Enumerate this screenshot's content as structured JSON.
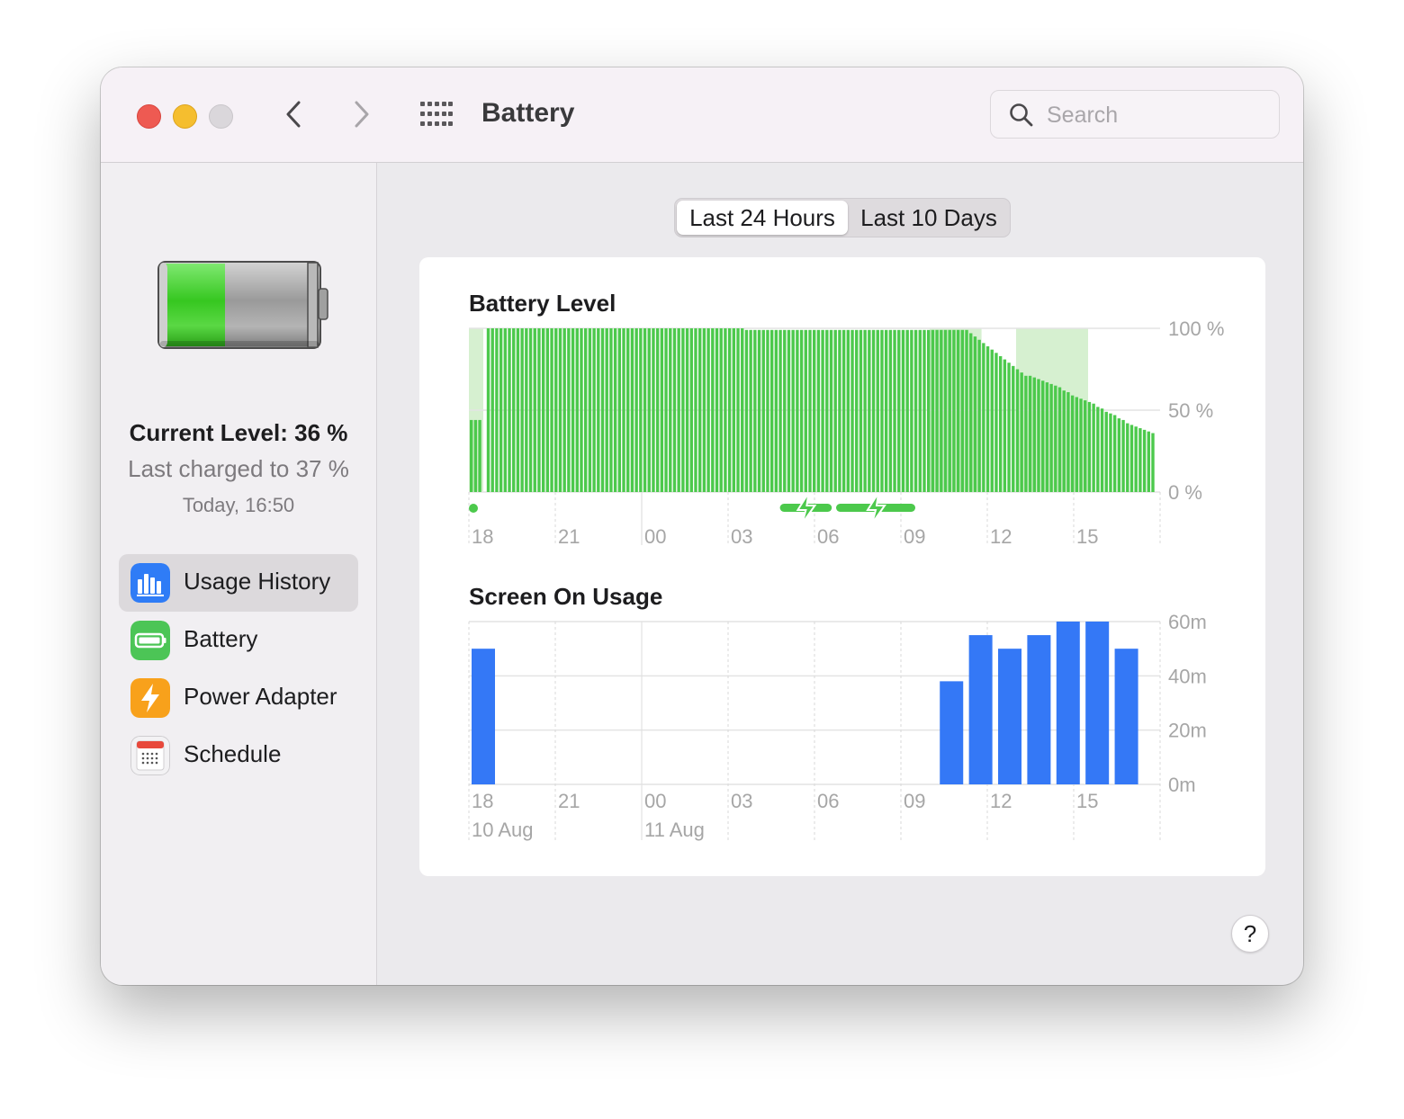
{
  "window": {
    "title": "Battery",
    "search": {
      "placeholder": "Search",
      "value": ""
    }
  },
  "sidebar": {
    "battery_icon": "battery-icon",
    "current_level": "Current Level: 36 %",
    "last_charged": "Last charged to 37 %",
    "charged_time": "Today, 16:50",
    "items": [
      {
        "label": "Usage History",
        "icon": "chart-icon",
        "color": "#2f7cf6",
        "selected": true
      },
      {
        "label": "Battery",
        "icon": "battery-icon",
        "color": "#4cc556",
        "selected": false
      },
      {
        "label": "Power Adapter",
        "icon": "bolt-icon",
        "color": "#f8a11b",
        "selected": false
      },
      {
        "label": "Schedule",
        "icon": "calendar-icon",
        "color": "#e5e3e6",
        "selected": false
      }
    ]
  },
  "range": {
    "options": [
      "Last 24 Hours",
      "Last 10 Days"
    ],
    "selected": "Last 24 Hours"
  },
  "help": {
    "label": "?"
  },
  "chart_data": [
    {
      "type": "bar",
      "title": "Battery Level",
      "color": "#4cc94c",
      "charging_color": "#d6f0d0",
      "ylim": [
        0,
        100
      ],
      "y_ticks": [
        "100 %",
        "50 %",
        "0 %"
      ],
      "x_ticks": [
        "18",
        "21",
        "00",
        "03",
        "06",
        "09",
        "12",
        "15"
      ],
      "values": [
        44,
        44,
        44,
        0,
        100,
        100,
        100,
        100,
        100,
        100,
        100,
        100,
        100,
        100,
        100,
        100,
        100,
        100,
        100,
        100,
        100,
        100,
        100,
        100,
        100,
        100,
        100,
        100,
        100,
        100,
        100,
        100,
        100,
        100,
        100,
        100,
        100,
        100,
        100,
        100,
        100,
        100,
        100,
        100,
        100,
        100,
        100,
        100,
        100,
        100,
        100,
        100,
        100,
        100,
        100,
        100,
        100,
        100,
        100,
        100,
        100,
        100,
        100,
        100,
        100,
        99,
        99,
        99,
        99,
        99,
        99,
        99,
        99,
        99,
        99,
        99,
        99,
        99,
        99,
        99,
        99,
        99,
        99,
        99,
        99,
        99,
        99,
        99,
        99,
        99,
        99,
        99,
        99,
        99,
        99,
        99,
        99,
        99,
        99,
        99,
        99,
        99,
        99,
        99,
        99,
        99,
        99,
        99,
        99,
        99,
        99,
        99,
        99,
        99,
        99,
        99,
        99,
        99,
        97,
        95,
        93,
        91,
        89,
        87,
        85,
        83,
        81,
        79,
        77,
        75,
        73,
        71,
        71,
        70,
        69,
        68,
        67,
        66,
        65,
        64,
        62,
        61,
        59,
        58,
        57,
        56,
        55,
        54,
        52,
        51,
        49,
        48,
        47,
        45,
        44,
        42,
        41,
        40,
        39,
        38,
        37,
        36
      ],
      "charging_periods": [
        [
          0,
          0.5
        ],
        [
          16,
          17.8
        ],
        [
          19,
          21.5
        ]
      ],
      "charging_bars": [
        [
          10.8,
          12.6
        ],
        [
          12.75,
          15.5
        ]
      ]
    },
    {
      "type": "bar",
      "title": "Screen On Usage",
      "color": "#3478f6",
      "ylim": [
        0,
        60
      ],
      "y_ticks": [
        "60m",
        "40m",
        "20m",
        "0m"
      ],
      "x_ticks": [
        "18",
        "21",
        "00",
        "03",
        "06",
        "09",
        "12",
        "15"
      ],
      "date_labels": [
        "10 Aug",
        "11 Aug"
      ],
      "values": [
        50,
        0,
        0,
        0,
        0,
        0,
        0,
        0,
        0,
        0,
        0,
        0,
        0,
        0,
        0,
        0,
        38,
        55,
        50,
        55,
        60,
        60,
        50
      ]
    }
  ]
}
